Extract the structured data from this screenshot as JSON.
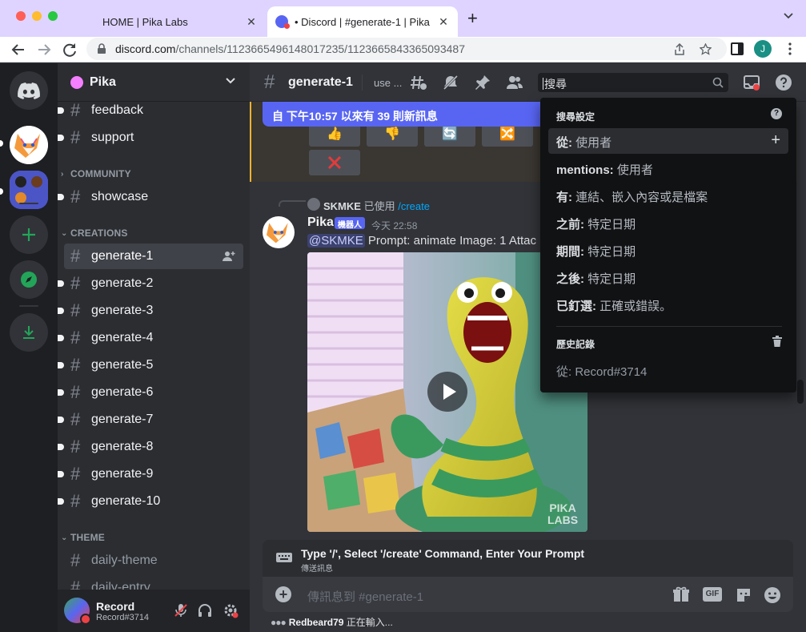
{
  "browser": {
    "tabs": [
      {
        "title": "HOME | Pika Labs",
        "active": false
      },
      {
        "title": "• Discord | #generate-1 | Pika",
        "active": true
      }
    ],
    "url_domain": "discord.com",
    "url_path": "/channels/1123665496148017235/1123665843365093487",
    "profile_initial": "J"
  },
  "server": {
    "name": "Pika",
    "categories": [
      {
        "name": "COMMUNITY"
      },
      {
        "name": "CREATIONS"
      },
      {
        "name": "THEME"
      }
    ],
    "channels_top": [
      "feedback",
      "support"
    ],
    "community_channels": [
      "showcase"
    ],
    "creation_channels": [
      "generate-1",
      "generate-2",
      "generate-3",
      "generate-4",
      "generate-5",
      "generate-6",
      "generate-7",
      "generate-8",
      "generate-9",
      "generate-10"
    ],
    "theme_channels": [
      "daily-theme",
      "daily-entry"
    ]
  },
  "user": {
    "name": "Record",
    "tag": "Record#3714"
  },
  "channel": {
    "name": "generate-1",
    "topic": "use ..."
  },
  "search": {
    "value": "搜尋",
    "options_header": "搜尋設定",
    "options": [
      {
        "key": "從:",
        "value": "使用者"
      },
      {
        "key": "mentions:",
        "value": "使用者"
      },
      {
        "key": "有:",
        "value": "連結、嵌入內容或是檔案"
      },
      {
        "key": "之前:",
        "value": "特定日期"
      },
      {
        "key": "期間:",
        "value": "特定日期"
      },
      {
        "key": "之後:",
        "value": "特定日期"
      },
      {
        "key": "已釘選:",
        "value": "正確或錯誤。"
      }
    ],
    "history_header": "歷史記錄",
    "history": [
      {
        "text": "從: Record#3714"
      }
    ]
  },
  "messages": {
    "new_messages_banner": "自 下午10:57 以來有 39 則新訊息",
    "reference": {
      "user": "SKMKE",
      "used": "已使用",
      "command": "/create"
    },
    "message": {
      "author": "Pika",
      "bot_tag": "機器人",
      "time": "今天 22:58",
      "mention": "@SKMKE",
      "text": " Prompt: animate  Image: 1 Attac"
    },
    "media_watermark_1": "PIKA",
    "media_watermark_2": "LABS"
  },
  "command_hint": {
    "title": "Type '/', Select '/create' Command, Enter Your Prompt",
    "subtitle": "傳送訊息"
  },
  "composer": {
    "placeholder": "傳訊息到 #generate-1",
    "gif_label": "GIF"
  },
  "typing": {
    "user": "Redbeard79",
    "suffix": " 正在輸入..."
  },
  "colors": {
    "blurple": "#5865f2",
    "sidebar": "#2b2d31",
    "main_bg": "#313338",
    "guild_bar": "#1e1f22",
    "tab_bar": "#dfd4ff"
  }
}
